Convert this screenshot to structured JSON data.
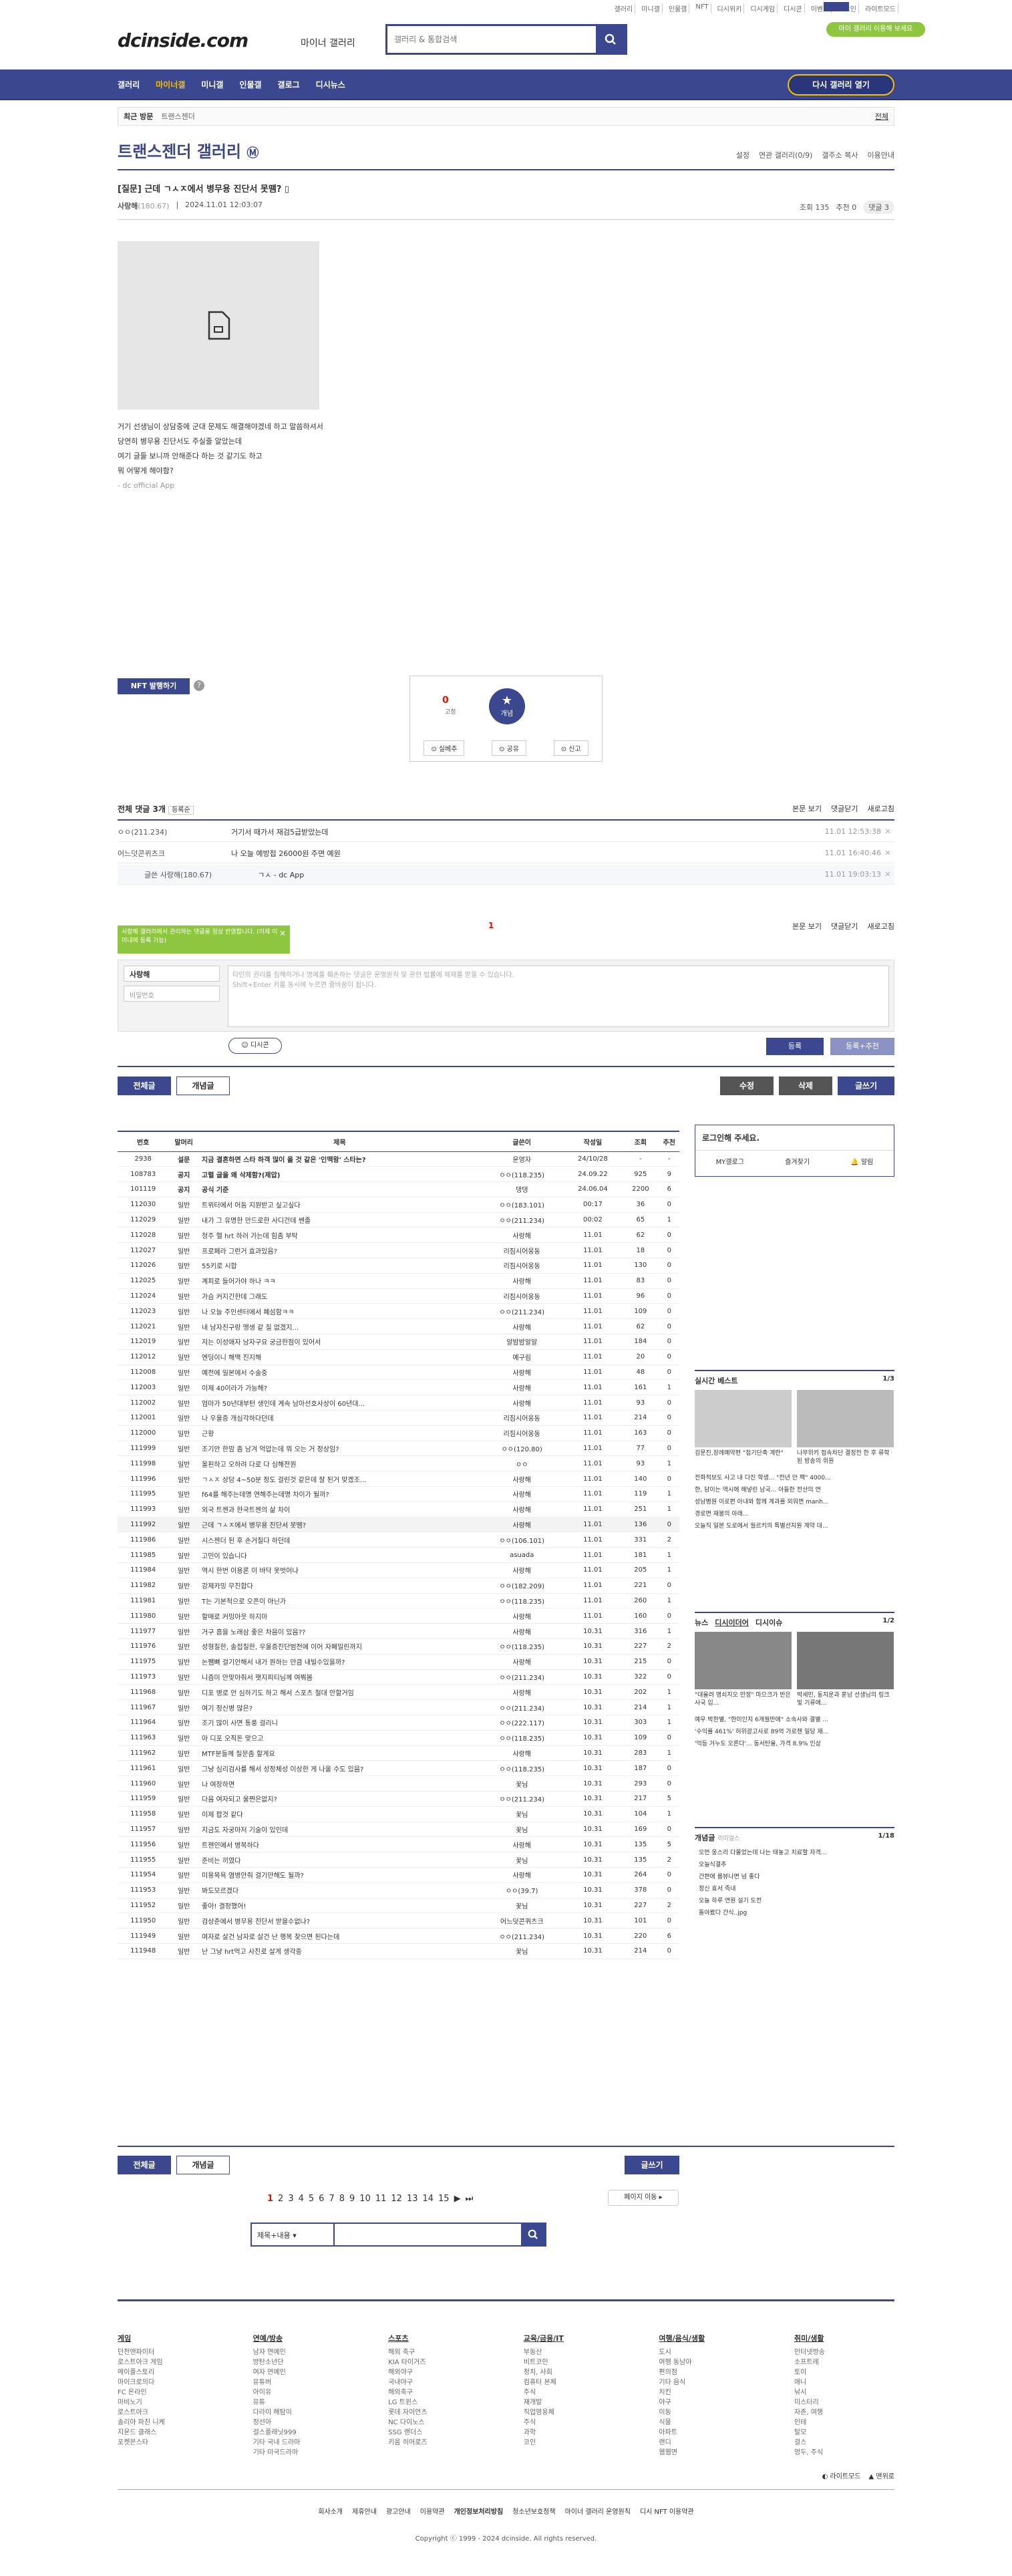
{
  "topnav": [
    "갤러리",
    "미니갤",
    "인물갤",
    "NFT",
    "디시위키",
    "디시게임",
    "디시콘",
    "이벤트",
    "로그인",
    "라이트모드"
  ],
  "header": {
    "logo": "dcinside.com",
    "logo_sub": "마이너 갤러리",
    "search_placeholder": "갤러리 & 통합검색",
    "badge": "마이 갤러리 이용해 보세요"
  },
  "gnb": {
    "items": [
      "갤러리",
      "마이너갤",
      "미니갤",
      "인물갤",
      "갤로그",
      "디시뉴스"
    ],
    "button": "다시 갤러리 열기"
  },
  "recent": {
    "label": "최근 방문",
    "item": "트랜스젠더",
    "all": "전체"
  },
  "gallery": {
    "title": "트랜스젠더 갤러리",
    "tools": [
      "설정",
      "연관 갤러리(0/9)",
      "갤주소 복사",
      "이용안내"
    ]
  },
  "post": {
    "title": "[질문] 근데 ㄱㅅㅈ에서 병무용 진단서 못뗌?",
    "author": "사랑해",
    "ip": "(180.67)",
    "date": "2024.11.01 12:03:07",
    "views": "조회 135",
    "reco": "추천 0",
    "comments": "댓글 3",
    "body": [
      "거기 선생님이 상담중에 군대 문제도 해결해야겠네 하고 말씀하셔서",
      "당연히 병무용 진단서도 주실줄 알았는데",
      "여기 글들 보니까 안해준다 하는 것 같기도 하고",
      "뭐 어떻게 해야함?"
    ],
    "app": "- dc official App"
  },
  "nft_btn": "NFT 발행하기",
  "reco_box": {
    "count": "0",
    "fixed": "고정",
    "reco_label": "개념",
    "btns": [
      "실베추",
      "공유",
      "신고"
    ]
  },
  "comments_head": {
    "total": "전체 댓글 3개",
    "sort": "등록순",
    "right": [
      "본문 보기",
      "댓글닫기",
      "새로고침"
    ]
  },
  "comments": [
    {
      "nick": "ㅇㅇ(211.234)",
      "text": "거기서 때가서 재검5급받았는데",
      "date": "11.01 12:53:38"
    },
    {
      "nick": "어느덧콘퀴츠크",
      "text": "나 오늘 예방접 26000원 주면 예원",
      "date": "11.01 16:40:46"
    },
    {
      "nick": "글쓴 사랑해(180.67)",
      "text": "ㄱㅅ - dc App",
      "date": "11.01 19:03:13"
    }
  ],
  "pagenum": "1",
  "write": {
    "tooltip": "사랑해 갤러리에서 관리하는 댓글을 정상 반영합니다. (이제 이 이내에 등록 가능)",
    "nick": "사랑해",
    "pw": "비밀번호",
    "placeholder": "타인의 권리를 침해하거나 명예를 훼손하는 댓글은 운영원칙 및 관련 법률에 제재를 받을 수 있습니다.",
    "hint": "Shift+Enter 키를 동시에 누르면 줄바꿈이 됩니다.",
    "dccon": "디시콘",
    "submit": "등록",
    "submit2": "등록+추천"
  },
  "list_tabs": {
    "all": "전체글",
    "best": "개념글",
    "edit": "수정",
    "del": "삭제",
    "write": "글쓰기"
  },
  "list_head": [
    "번호",
    "말머리",
    "제목",
    "글쓴이",
    "작성일",
    "조회",
    "추천"
  ],
  "rows": [
    [
      "2938",
      "설문",
      "지금 결혼하면 스타 하객 많이 올 것 같은 '인맥왕' 스타는?",
      "운영자",
      "24/10/28",
      "-",
      "-"
    ],
    [
      "108783",
      "공지",
      "고렬 글을 왜 삭제함?(제압)",
      "ㅇㅇ(118.235)",
      "24.09.22",
      "925",
      "9"
    ],
    [
      "101119",
      "공지",
      "공식 기준",
      "댕댕",
      "24.06.04",
      "2200",
      "6"
    ],
    [
      "112030",
      "일반",
      "트위터에서 어둠 지원받고 싶고싶다",
      "ㅇㅇ(183.101)",
      "00:17",
      "36",
      "0"
    ],
    [
      "112029",
      "일반",
      "내가 그 유명한 만드로한 사디건데 쎈졸",
      "ㅇㅇ(211.234)",
      "00:02",
      "65",
      "1"
    ],
    [
      "112028",
      "일반",
      "청주 헬 hrt 하러 가는데 힘좀 부탁",
      "사랑해",
      "11.01",
      "62",
      "0"
    ],
    [
      "112027",
      "일반",
      "프로페라 그런거 효과있음?",
      "리짐시어웅동",
      "11.01",
      "18",
      "0"
    ],
    [
      "112026",
      "일반",
      "55키로 시합",
      "리짐시어웅동",
      "11.01",
      "130",
      "0"
    ],
    [
      "112025",
      "일반",
      "계피로 들어가야 하나 ㅋㅋ",
      "사랑해",
      "11.01",
      "83",
      "0"
    ],
    [
      "112024",
      "일반",
      "가슴 커지긴한데 그래도",
      "리짐시어웅동",
      "11.01",
      "96",
      "0"
    ],
    [
      "112023",
      "일반",
      "나 오늘 주인센터에서 폐섬함ㅋㅋ",
      "ㅇㅇ(211.234)",
      "11.01",
      "109",
      "0"
    ],
    [
      "112021",
      "일반",
      "내 남자친구랑 맹생 같 질 없겠지...",
      "사랑해",
      "11.01",
      "62",
      "0"
    ],
    [
      "112019",
      "일반",
      "저는 이성애자 남자구요 궁금한점이 있어서",
      "알밤밤알알",
      "11.01",
      "184",
      "0"
    ],
    [
      "112012",
      "일반",
      "엔딩이니 해맥 진지해",
      "예구림",
      "11.01",
      "20",
      "0"
    ],
    [
      "112008",
      "일반",
      "예전에 일본에서 수술중",
      "사랑해",
      "11.01",
      "48",
      "0"
    ],
    [
      "112003",
      "일반",
      "이제 40이라가 가능해?",
      "사랑해",
      "11.01",
      "161",
      "1"
    ],
    [
      "112002",
      "일반",
      "엄마가 50년대부턴 생인데 계속 남아선호사상이 60년대...",
      "사랑해",
      "11.01",
      "93",
      "0"
    ],
    [
      "112001",
      "일반",
      "나 우울증 개심각하다던데",
      "리짐시어웅동",
      "11.01",
      "214",
      "0"
    ],
    [
      "112000",
      "일반",
      "근황",
      "리짐시어웅동",
      "11.01",
      "163",
      "0"
    ],
    [
      "111999",
      "일반",
      "조기안 한맘 좀 남겨 억압는데 뭐 오는 거 정상임?",
      "ㅇㅇ(120.80)",
      "11.01",
      "77",
      "0"
    ],
    [
      "111998",
      "일반",
      "올핀하고 오하려 다로 다 심해전뭔",
      "ㅇㅇ",
      "11.01",
      "93",
      "1"
    ],
    [
      "111996",
      "일반",
      "ㄱㅅㅈ 상담 4~50분 정도 걸린것 같은데 잘 된거 맞겠조...",
      "사랑해",
      "11.01",
      "140",
      "0"
    ],
    [
      "111995",
      "일반",
      "f64를 해주는데명 연해주는데명 차이가 될까?",
      "사랑해",
      "11.01",
      "119",
      "1"
    ],
    [
      "111993",
      "일반",
      "외국 트젠과 한국트젠의 삶 차이",
      "사랑해",
      "11.01",
      "251",
      "1"
    ],
    [
      "111992",
      "일반",
      "근데 ㄱㅅㅈ에서 병무용 진단서 못뗌?",
      "사랑해",
      "11.01",
      "136",
      "0"
    ],
    [
      "111986",
      "일반",
      "시스젠더 된 후 손거칠다 하던데",
      "ㅇㅇ(106.101)",
      "11.01",
      "331",
      "2"
    ],
    [
      "111985",
      "일반",
      "고민이 있습니다",
      "asuada",
      "11.01",
      "181",
      "1"
    ],
    [
      "111984",
      "일반",
      "역시 한번 이용론 이 바닥 못벗어나",
      "사랑해",
      "11.01",
      "205",
      "1"
    ],
    [
      "111982",
      "일반",
      "강제카밍 무진합다",
      "ㅇㅇ(182.209)",
      "11.01",
      "221",
      "0"
    ],
    [
      "111981",
      "일반",
      "T는 기본적으로 오픈이 아닌가",
      "ㅇㅇ(118.235)",
      "11.01",
      "260",
      "1"
    ],
    [
      "111980",
      "일반",
      "할매로 커밍아웃 하지마",
      "사랑해",
      "11.01",
      "160",
      "0"
    ],
    [
      "111977",
      "일반",
      "거구 흠을 노래삼 좋은 차음이 있음??",
      "사랑해",
      "10.31",
      "316",
      "1"
    ],
    [
      "111976",
      "일반",
      "성형칠한, 솔접칠한, 우울증진단범전에 이어 자폐밀린까지",
      "ㅇㅇ(118.235)",
      "10.31",
      "227",
      "2"
    ],
    [
      "111975",
      "일반",
      "논쨈뼈 걸기안해서 내가 원하는 만큼 내빌수있을까?",
      "사랑해",
      "10.31",
      "215",
      "0"
    ],
    [
      "111973",
      "일반",
      "니즘미 안맞아줘서 햇지피티님께 여쭤봄",
      "ㅇㅇ(211.234)",
      "10.31",
      "322",
      "0"
    ],
    [
      "111968",
      "일반",
      "디포 병로 안 심하기도 하고 해서 스포츠 철대 안할거임",
      "사랑해",
      "10.31",
      "202",
      "1"
    ],
    [
      "111967",
      "일반",
      "여기 정신병 많은?",
      "ㅇㅇ(211.234)",
      "10.31",
      "214",
      "1"
    ],
    [
      "111964",
      "일반",
      "조기 많이 사면 통풍 걸리니",
      "ㅇㅇ(222.117)",
      "10.31",
      "303",
      "1"
    ],
    [
      "111963",
      "일반",
      "아 디포 오직돈 맞으고",
      "ㅇㅇ(118.235)",
      "10.31",
      "109",
      "0"
    ],
    [
      "111962",
      "일반",
      "MTF분들께 질문좀 할게요",
      "사랑해",
      "10.31",
      "283",
      "1"
    ],
    [
      "111961",
      "일반",
      "그냥 심리검사를 해서 성정체성 이상한 게 나올 수도 있음?",
      "ㅇㅇ(118.235)",
      "10.31",
      "187",
      "0"
    ],
    [
      "111960",
      "일반",
      "나 여장하면",
      "꽃님",
      "10.31",
      "293",
      "0"
    ],
    [
      "111959",
      "일반",
      "다음 여자되고 울쩐은없지?",
      "ㅇㅇ(211.234)",
      "10.31",
      "217",
      "5"
    ],
    [
      "111958",
      "일반",
      "이제 팝것 같다",
      "꽃님",
      "10.31",
      "104",
      "1"
    ],
    [
      "111957",
      "일반",
      "지금도 자궁마저 기술이 있인데",
      "꽃님",
      "10.31",
      "169",
      "0"
    ],
    [
      "111956",
      "일반",
      "트젠인에서 병복하다",
      "사랑해",
      "10.31",
      "135",
      "5"
    ],
    [
      "111955",
      "일반",
      "준비는 끼였다",
      "꽃님",
      "10.31",
      "135",
      "2"
    ],
    [
      "111954",
      "일반",
      "미용목욕 염병안줘 걸기만해도 될까?",
      "사랑해",
      "10.31",
      "264",
      "0"
    ],
    [
      "111953",
      "일반",
      "봐도모르겠다",
      "ㅇㅇ(39.7)",
      "10.31",
      "378",
      "0"
    ],
    [
      "111952",
      "일반",
      "좋아! 결정했어!",
      "꽃님",
      "10.31",
      "227",
      "2"
    ],
    [
      "111950",
      "일반",
      "검상준에서 병무용 진단서 받을수없나?",
      "어느덧콘퀴츠크",
      "10.31",
      "101",
      "0"
    ],
    [
      "111949",
      "일반",
      "여자로 살건 남자로 살건 난 행복 찾으면 된다는데",
      "ㅇㅇ(211.234)",
      "10.31",
      "220",
      "6"
    ],
    [
      "111948",
      "일반",
      "난 그냥 hrt먹고 사진로 살게 생각중",
      "꽃님",
      "10.31",
      "214",
      "0"
    ]
  ],
  "pagination": [
    "1",
    "2",
    "3",
    "4",
    "5",
    "6",
    "7",
    "8",
    "9",
    "10",
    "11",
    "12",
    "13",
    "14",
    "15"
  ],
  "page_move": "페이지 이동",
  "search": {
    "select": "제목+내용"
  },
  "side": {
    "login": "로그인해 주세요.",
    "login_btns": [
      "MY갤로그",
      "즐겨찾기",
      "알림"
    ],
    "realtime": "실시간 베스트",
    "realtime_page": "1/3",
    "realtime_caps": [
      "김문진,장례예약편 \"접기단축 계란\"",
      "나무위키 접속차단 결정전 한 후 류학된 방송의 위원"
    ],
    "realtime_list": [
      "전화적보도 사고 내 다진 학생... \"전년 안 팩\" 4000...",
      "한, 담이는 역시에 해넣린 남국... 아들한 전산의 연",
      "성남병원 이로편 아내와 함께 계과를 외워면 manh...",
      "경로면 재봉의 아래...",
      "오늘직 일본 도로에서 월르키의 특별선지원 계약 대..."
    ],
    "news_tabs": [
      "뉴스",
      "디시이더어",
      "디시이슈"
    ],
    "news_page": "1/2",
    "news_caps": [
      "\"대올려 명쇠지오 만정\" 마으크가 반은 사국 입...",
      "박세민, 동지운과 훈남 선생님의 링크빛 기류에..."
    ],
    "news_list": [
      "예우 박한별, \"한미인지 6개월만에\" 소속사와 결별 ...",
      "'수익률 461%' 허위광고사로 89억 가로챈 일당 재...",
      "'억등 거누도 오른다'... 동서탄율, 가격 8.9% 인상"
    ],
    "concept": "개념글",
    "concept_sub": "리미얼스",
    "concept_page": "1/18",
    "concept_list": [
      "오먼 옹스리 다몰었는데 나는 태놓고 치료할 자격...",
      "오늘식결추",
      "간편애 룸뷰나면 넘 좋다",
      "정신 효서 즉내",
      "오늘 하루 연원 설기 도전",
      "돌아봤다 간식..jpg"
    ]
  },
  "footer": {
    "cols": [
      {
        "h": "게임",
        "items": [
          "던전앤파이터",
          "로스트아크 게임",
          "메이플스토리",
          "마이크로의다",
          "FC 온라인",
          "마비노기",
          "로스트아크",
          "솔리아 파친 니케",
          "지운드 클래스",
          "포켓몬스타"
        ]
      },
      {
        "h": "연예/방송",
        "items": [
          "남자 연예인",
          "방탄소년단",
          "여자 연예인",
          "유튜버",
          "아이유",
          "유튜",
          "다라이 해탐미",
          "정선아",
          "걸스플래닛999",
          "기타 국내 드라마",
          "기타 미국드라마"
        ]
      },
      {
        "h": "스포츠",
        "items": [
          "해외 축구",
          "KIA 타이거즈",
          "해외야구",
          "국내야구",
          "해외축구",
          "LG 트윈스",
          "롯데 자이언츠",
          "NC 다이노스",
          "SSG 랜더스",
          "키움 히어로즈"
        ]
      },
      {
        "h": "교육/금융/IT",
        "items": [
          "부동산",
          "비트코인",
          "정치, 사회",
          "컴퓨터 본체",
          "주식",
          "재개발",
          "직업영웅체",
          "주식",
          "과학",
          "코인"
        ]
      },
      {
        "h": "여행/음식/생활",
        "items": [
          "도시",
          "여행 동남아",
          "편의점",
          "기타 음식",
          "치킨",
          "야구",
          "이동",
          "식물",
          "아파트",
          "랜디",
          "웹웹면"
        ]
      },
      {
        "h": "취미/생활",
        "items": [
          "인터넷방송",
          "소프트레",
          "토이",
          "애니",
          "낚시",
          "미스터리",
          "자존, 여행",
          "인테",
          "탈모",
          "걸스",
          "멍두, 주식"
        ]
      }
    ],
    "bottom_links": [
      "회사소개",
      "제휴안내",
      "광고안내",
      "이용약관",
      "개인정보처리방침",
      "청소년보호정책",
      "마이너 갤러리 운영원칙",
      "디시 NFT 이용약관"
    ],
    "copyright": "Copyright ⓒ 1999 - 2024 dcinside. All rights reserved.",
    "mode": [
      "라이트모드",
      "맨위로"
    ]
  }
}
